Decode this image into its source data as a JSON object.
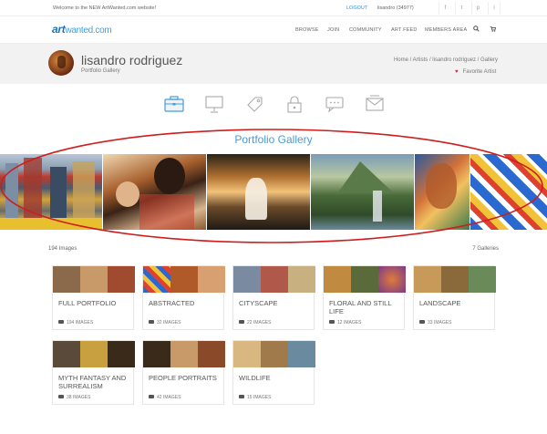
{
  "topbar": {
    "welcome": "Welcome to the NEW ArtWanted.com website!",
    "logout": "LOGOUT",
    "user": "lisandro (34977)",
    "social": [
      "f",
      "t",
      "p",
      "i"
    ]
  },
  "nav": {
    "logo_art": "art",
    "logo_rest": "wanted.com",
    "items": [
      "BROWSE",
      "JOIN",
      "COMMUNITY",
      "ART FEED",
      "MEMBERS AREA"
    ]
  },
  "profile": {
    "name": "lisandro rodriguez",
    "subtitle": "Portfolio Gallery",
    "breadcrumb": "Home / Artists / lisandro rodriguez / Gallery",
    "favorite": "Favorite Artist"
  },
  "tabs": [
    "portfolio-tab",
    "presentation-tab",
    "price-tag-tab",
    "lock-tab",
    "comments-tab",
    "mail-tab"
  ],
  "gallery": {
    "title": "Portfolio Gallery",
    "images_count": "194 Images",
    "galleries_count": "7 Galleries"
  },
  "albums": [
    {
      "title": "FULL PORTFOLIO",
      "count": "194 IMAGES"
    },
    {
      "title": "ABSTRACTED",
      "count": "32 IMAGES"
    },
    {
      "title": "CITYSCAPE",
      "count": "22 IMAGES"
    },
    {
      "title": "FLORAL AND STILL LIFE",
      "count": "12 IMAGES"
    },
    {
      "title": "LANDSCAPE",
      "count": "33 IMAGES"
    },
    {
      "title": "MYTH FANTASY AND SURREALISM",
      "count": "38 IMAGES"
    },
    {
      "title": "PEOPLE PORTRAITS",
      "count": "42 IMAGES"
    },
    {
      "title": "WILDLIFE",
      "count": "15 IMAGES"
    }
  ],
  "colors": {
    "accent": "#4a9ad8",
    "heart": "#d9283a",
    "annotation": "#d01c1c"
  }
}
